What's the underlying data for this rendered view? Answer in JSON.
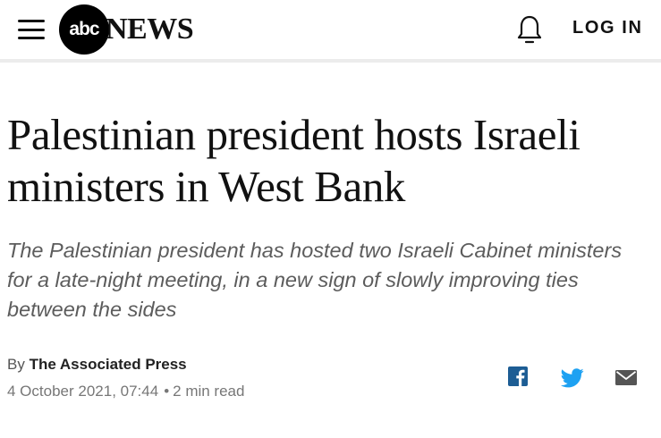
{
  "header": {
    "logo_mark": "abc",
    "logo_word": "NEWS",
    "login_label": "LOG IN",
    "menu_icon": "hamburger-menu-icon",
    "bell_icon": "bell-icon"
  },
  "article": {
    "headline": "Palestinian president hosts Israeli ministers in West Bank",
    "dek": "The Palestinian president has hosted two Israeli Cabinet ministers for a late-night meeting, in a new sign of slowly improving ties between the sides",
    "byline_prefix": "By",
    "author": "The Associated Press",
    "date": "4 October 2021, 07:44",
    "bullet": "•",
    "read_time": "2 min read"
  },
  "share": {
    "facebook_icon": "facebook-icon",
    "twitter_icon": "twitter-icon",
    "email_icon": "email-icon"
  },
  "colors": {
    "facebook": "#1d5d94",
    "twitter": "#1da1f2",
    "email": "#555555",
    "divider": "#ececec",
    "dek_text": "#5c5c5c"
  }
}
